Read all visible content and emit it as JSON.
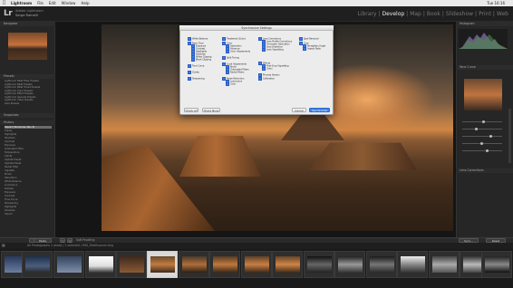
{
  "menubar": {
    "items": [
      "Lightroom",
      "File",
      "Edit",
      "Window",
      "Help"
    ],
    "clock": "Tue 16:16"
  },
  "header": {
    "logo": "Lr",
    "catalog_line1": "Adobe Lightroom",
    "catalog_line2": "Serge Ramelli",
    "modules": [
      "Library",
      "|",
      "Develop",
      "|",
      "Map",
      "|",
      "Book",
      "|",
      "Slideshow",
      "|",
      "Print",
      "|",
      "Web"
    ],
    "active_module": "Develop"
  },
  "left_panel": {
    "navigator_label": "Navigator",
    "presets_label": "Presets",
    "presets": [
      "Lightroom B&W Filter Presets",
      "Lightroom B&W Presets",
      "Lightroom B&W Toned Presets",
      "Lightroom Color Presets",
      "Lightroom Effect Presets",
      "Lightroom General Presets",
      "Lightroom Video Presets",
      "User Presets"
    ],
    "snapshots_label": "Snapshots",
    "history_label": "History",
    "history": [
      "Import (Tomorrow, Nov 3)",
      "Clarity",
      "Highlights",
      "Shadows",
      "Contrast",
      "Exposure",
      "Graduated Filter",
      "Temperature",
      "Clarity",
      "Update Preset",
      "Update Preset",
      "Radial Filter",
      "Vignette",
      "Brush",
      "Saturation",
      "White Balance",
      "Luminance",
      "Dehaze",
      "Exposure",
      "Contrast",
      "Tone Curve",
      "Sharpening",
      "Highlights",
      "Shadows",
      "Import"
    ]
  },
  "dialog": {
    "title": "Synchronize Settings",
    "col1": [
      "White Balance",
      "Basic Tone",
      "Exposure",
      "Contrast",
      "Highlights",
      "Shadows",
      "White Clipping",
      "Black Clipping",
      "Tone Curve",
      "Clarity",
      "Sharpening"
    ],
    "col2": [
      "Treatment (Color)",
      "Color",
      "Saturation",
      "Vibrance",
      "Color Adjustments",
      "Split Toning",
      "Local Adjustments",
      "Brush",
      "Graduated Filters",
      "Radial Filters",
      "Noise Reduction",
      "Luminance",
      "Color"
    ],
    "col3": [
      "Lens Corrections",
      "Lens Profile Corrections",
      "Chromatic Aberration",
      "Lens Distortion",
      "Lens Vignetting",
      "Effects",
      "Post-Crop Vignetting",
      "Grain",
      "Process Version",
      "Calibration"
    ],
    "col4": [
      "Spot Removal",
      "Crop",
      "Straighten Angle",
      "Aspect Ratio"
    ],
    "check_all": "Check All",
    "check_none": "Check None",
    "cancel": "Cancel",
    "synchronize": "Synchronize"
  },
  "toolbar": {
    "prev_label": "Copy...",
    "paste_label": "Paste",
    "soft_proofing": "Soft Proofing",
    "sync_label": "Sync...",
    "reset_label": "Reset"
  },
  "filmstrip": {
    "path": "All Photographs  1 photo / 1 selected / IMG_Teotihuacan.dng",
    "selected_index": 4
  },
  "right_panel": {
    "histogram_label": "Histogram",
    "tone_curve_label": "Tone Curve",
    "lens_label": "Lens Corrections"
  }
}
